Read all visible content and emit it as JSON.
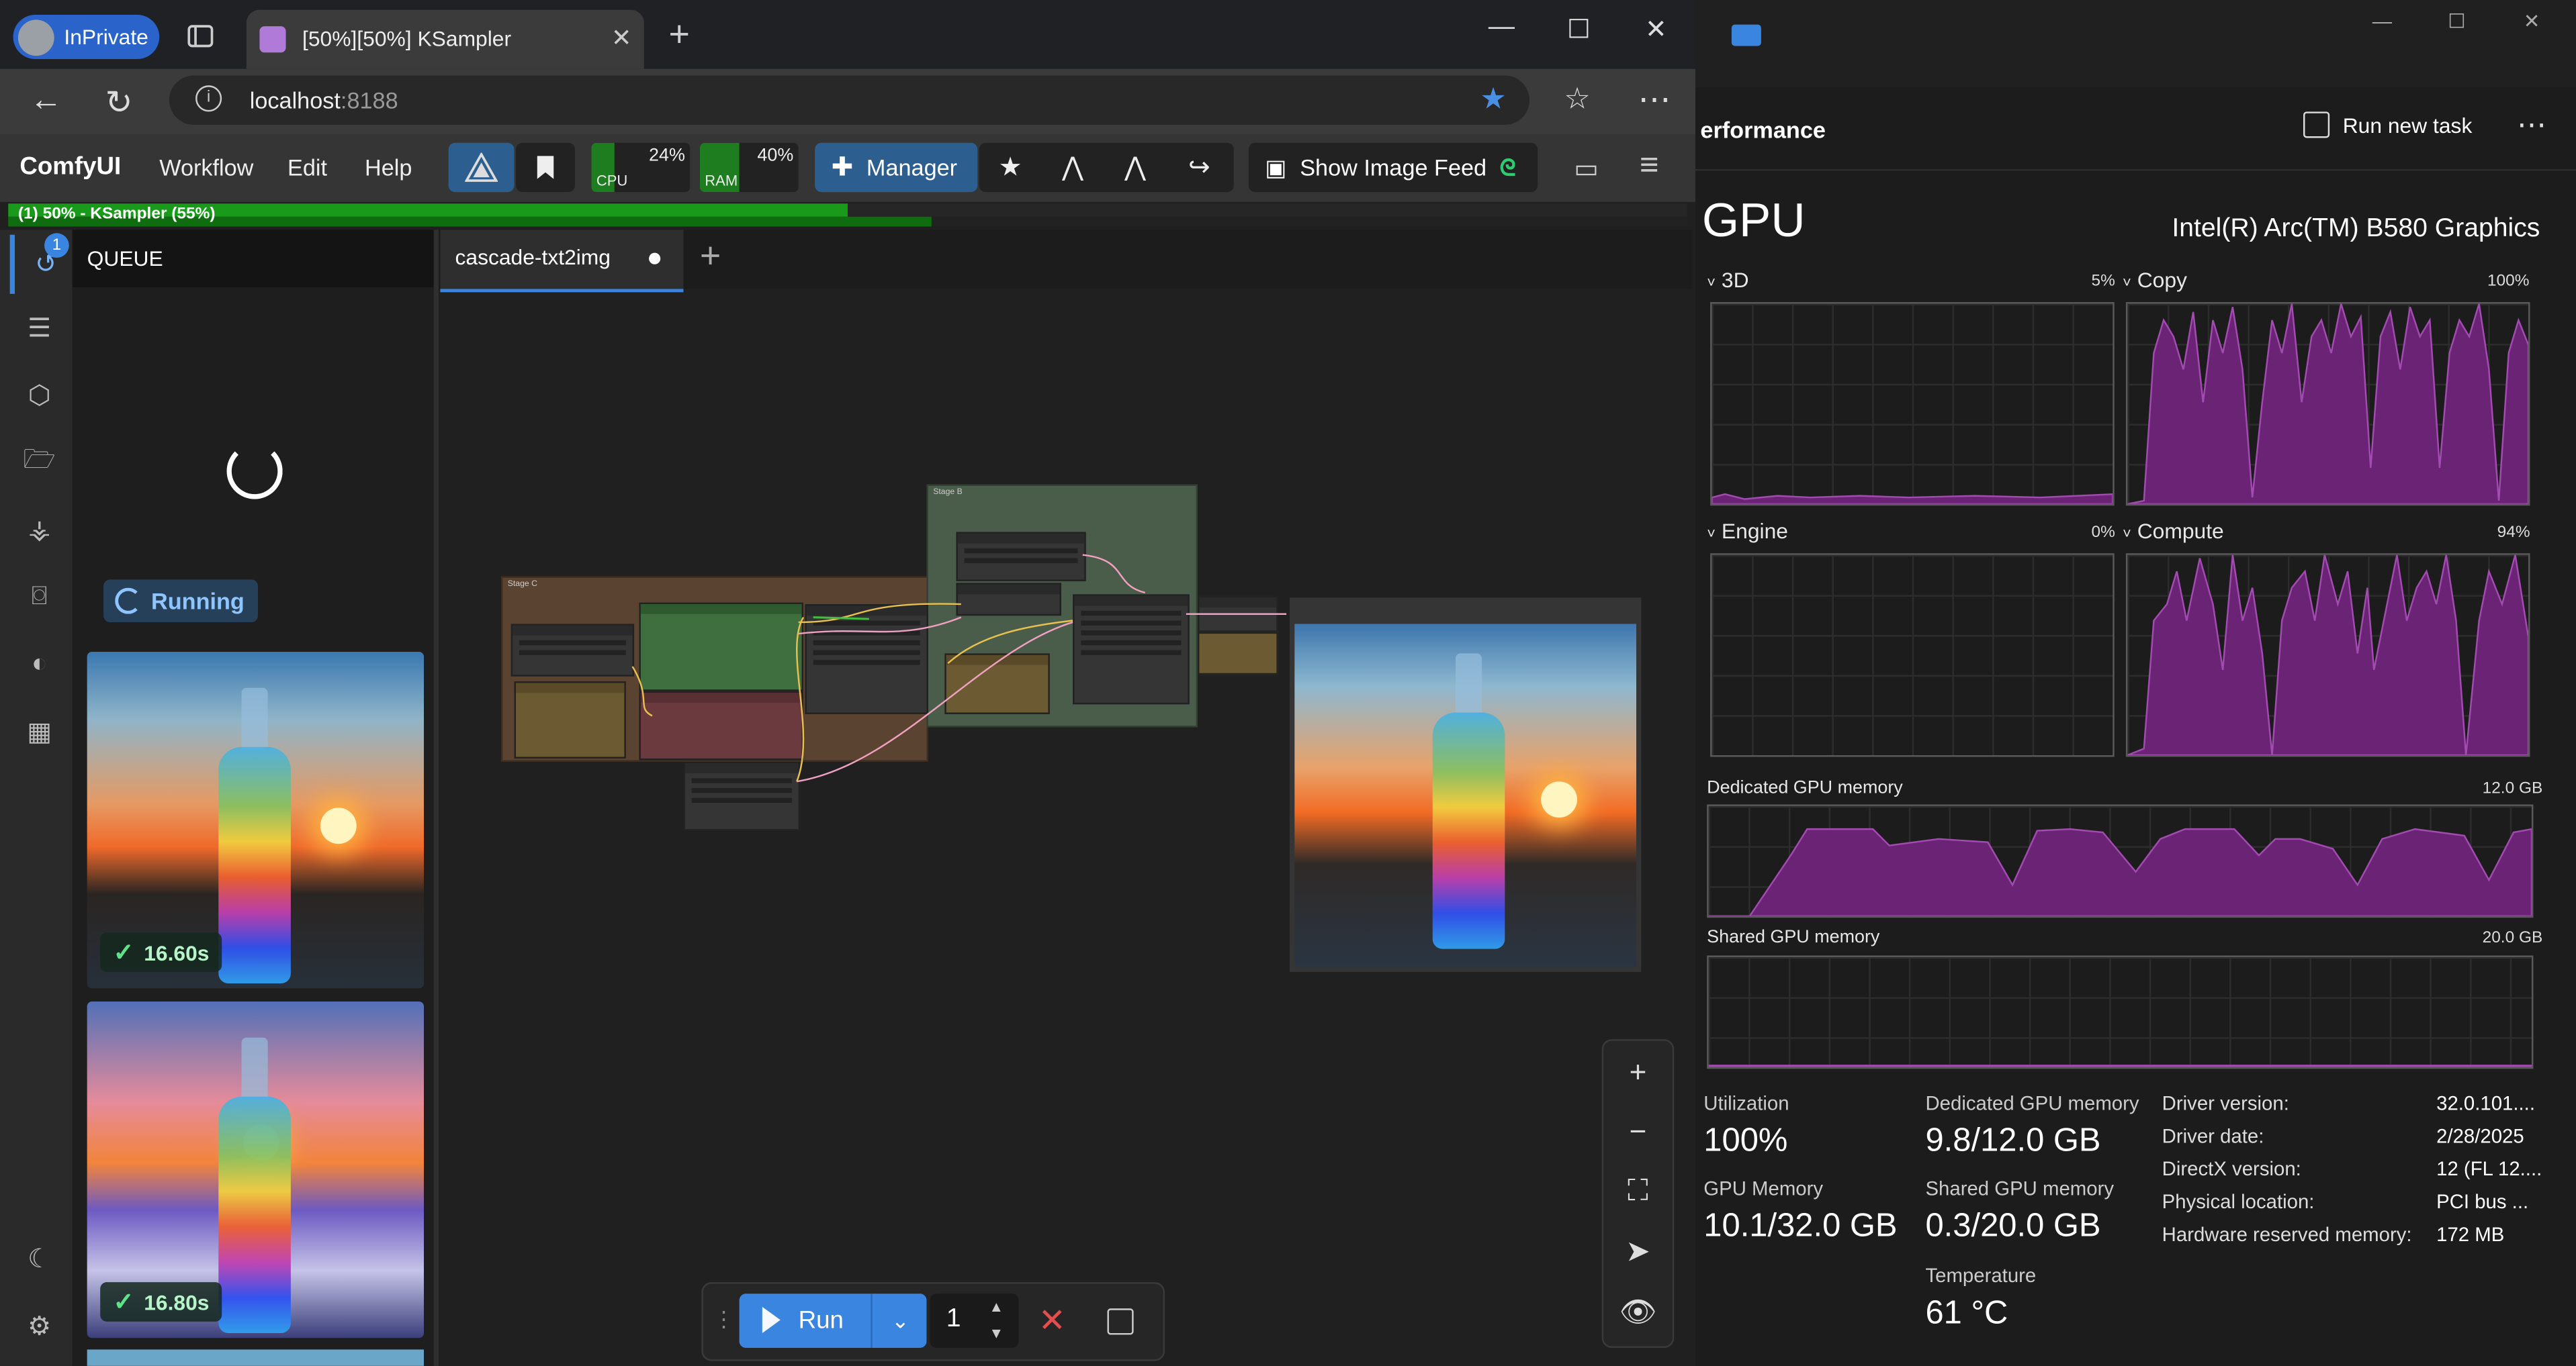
{
  "browser": {
    "inprivate_label": "InPrivate",
    "tab_title": "[50%][50%] KSampler",
    "close_tab": "✕",
    "new_tab": "+",
    "url_host": "localhost",
    "url_port": ":8188",
    "window_min": "—",
    "window_max": "☐",
    "window_close": "✕"
  },
  "comfy": {
    "brand": "ComfyUI",
    "menus": [
      "Workflow",
      "Edit",
      "Help"
    ],
    "cpu_label": "CPU",
    "cpu_pct": "24%",
    "cpu_value": 24,
    "ram_label": "RAM",
    "ram_pct": "40%",
    "ram_value": 40,
    "manager_label": "Manager",
    "show_feed_label": "Show Image Feed",
    "progress_text": "(1) 50% - KSampler (55%)",
    "progress_main": 50,
    "progress_sub": 55
  },
  "queue": {
    "title": "QUEUE",
    "badge": "1",
    "running_label": "Running",
    "items": [
      {
        "time": "16.60s"
      },
      {
        "time": "16.80s"
      }
    ]
  },
  "workflow": {
    "tab_name": "cascade-txt2img",
    "group_stage_c": "Stage C",
    "group_stage_b": "Stage B"
  },
  "runbar": {
    "run_label": "Run",
    "batch_count": "1"
  },
  "taskmanager": {
    "section": "erformance",
    "run_new_task": "Run new task",
    "gpu_title": "GPU",
    "gpu_name": "Intel(R) Arc(TM) B580 Graphics",
    "graphs": [
      {
        "label": "3D",
        "pct": "5%"
      },
      {
        "label": "Copy",
        "pct": "100%"
      },
      {
        "label": "Engine",
        "pct": "0%"
      },
      {
        "label": "Compute",
        "pct": "94%"
      }
    ],
    "dedicated_label": "Dedicated GPU memory",
    "dedicated_max": "12.0 GB",
    "shared_label": "Shared GPU memory",
    "shared_max": "20.0 GB",
    "stats": {
      "utilization_label": "Utilization",
      "utilization_value": "100%",
      "gpu_memory_label": "GPU Memory",
      "gpu_memory_value": "10.1/32.0 GB",
      "dedicated_mem_label": "Dedicated GPU memory",
      "dedicated_mem_value": "9.8/12.0 GB",
      "shared_mem_label": "Shared GPU memory",
      "shared_mem_value": "0.3/20.0 GB",
      "temperature_label": "Temperature",
      "temperature_value": "61 °C"
    },
    "details": [
      {
        "label": "Driver version:",
        "value": "32.0.101...."
      },
      {
        "label": "Driver date:",
        "value": "2/28/2025"
      },
      {
        "label": "DirectX version:",
        "value": "12 (FL 12...."
      },
      {
        "label": "Physical location:",
        "value": "PCI bus ..."
      },
      {
        "label": "Hardware reserved memory:",
        "value": "172 MB"
      }
    ]
  },
  "colors": {
    "accent": "#3a85e0",
    "graph_fill": "#6b2475",
    "graph_line": "#a24bb0",
    "progress": "#1a9a1a"
  }
}
